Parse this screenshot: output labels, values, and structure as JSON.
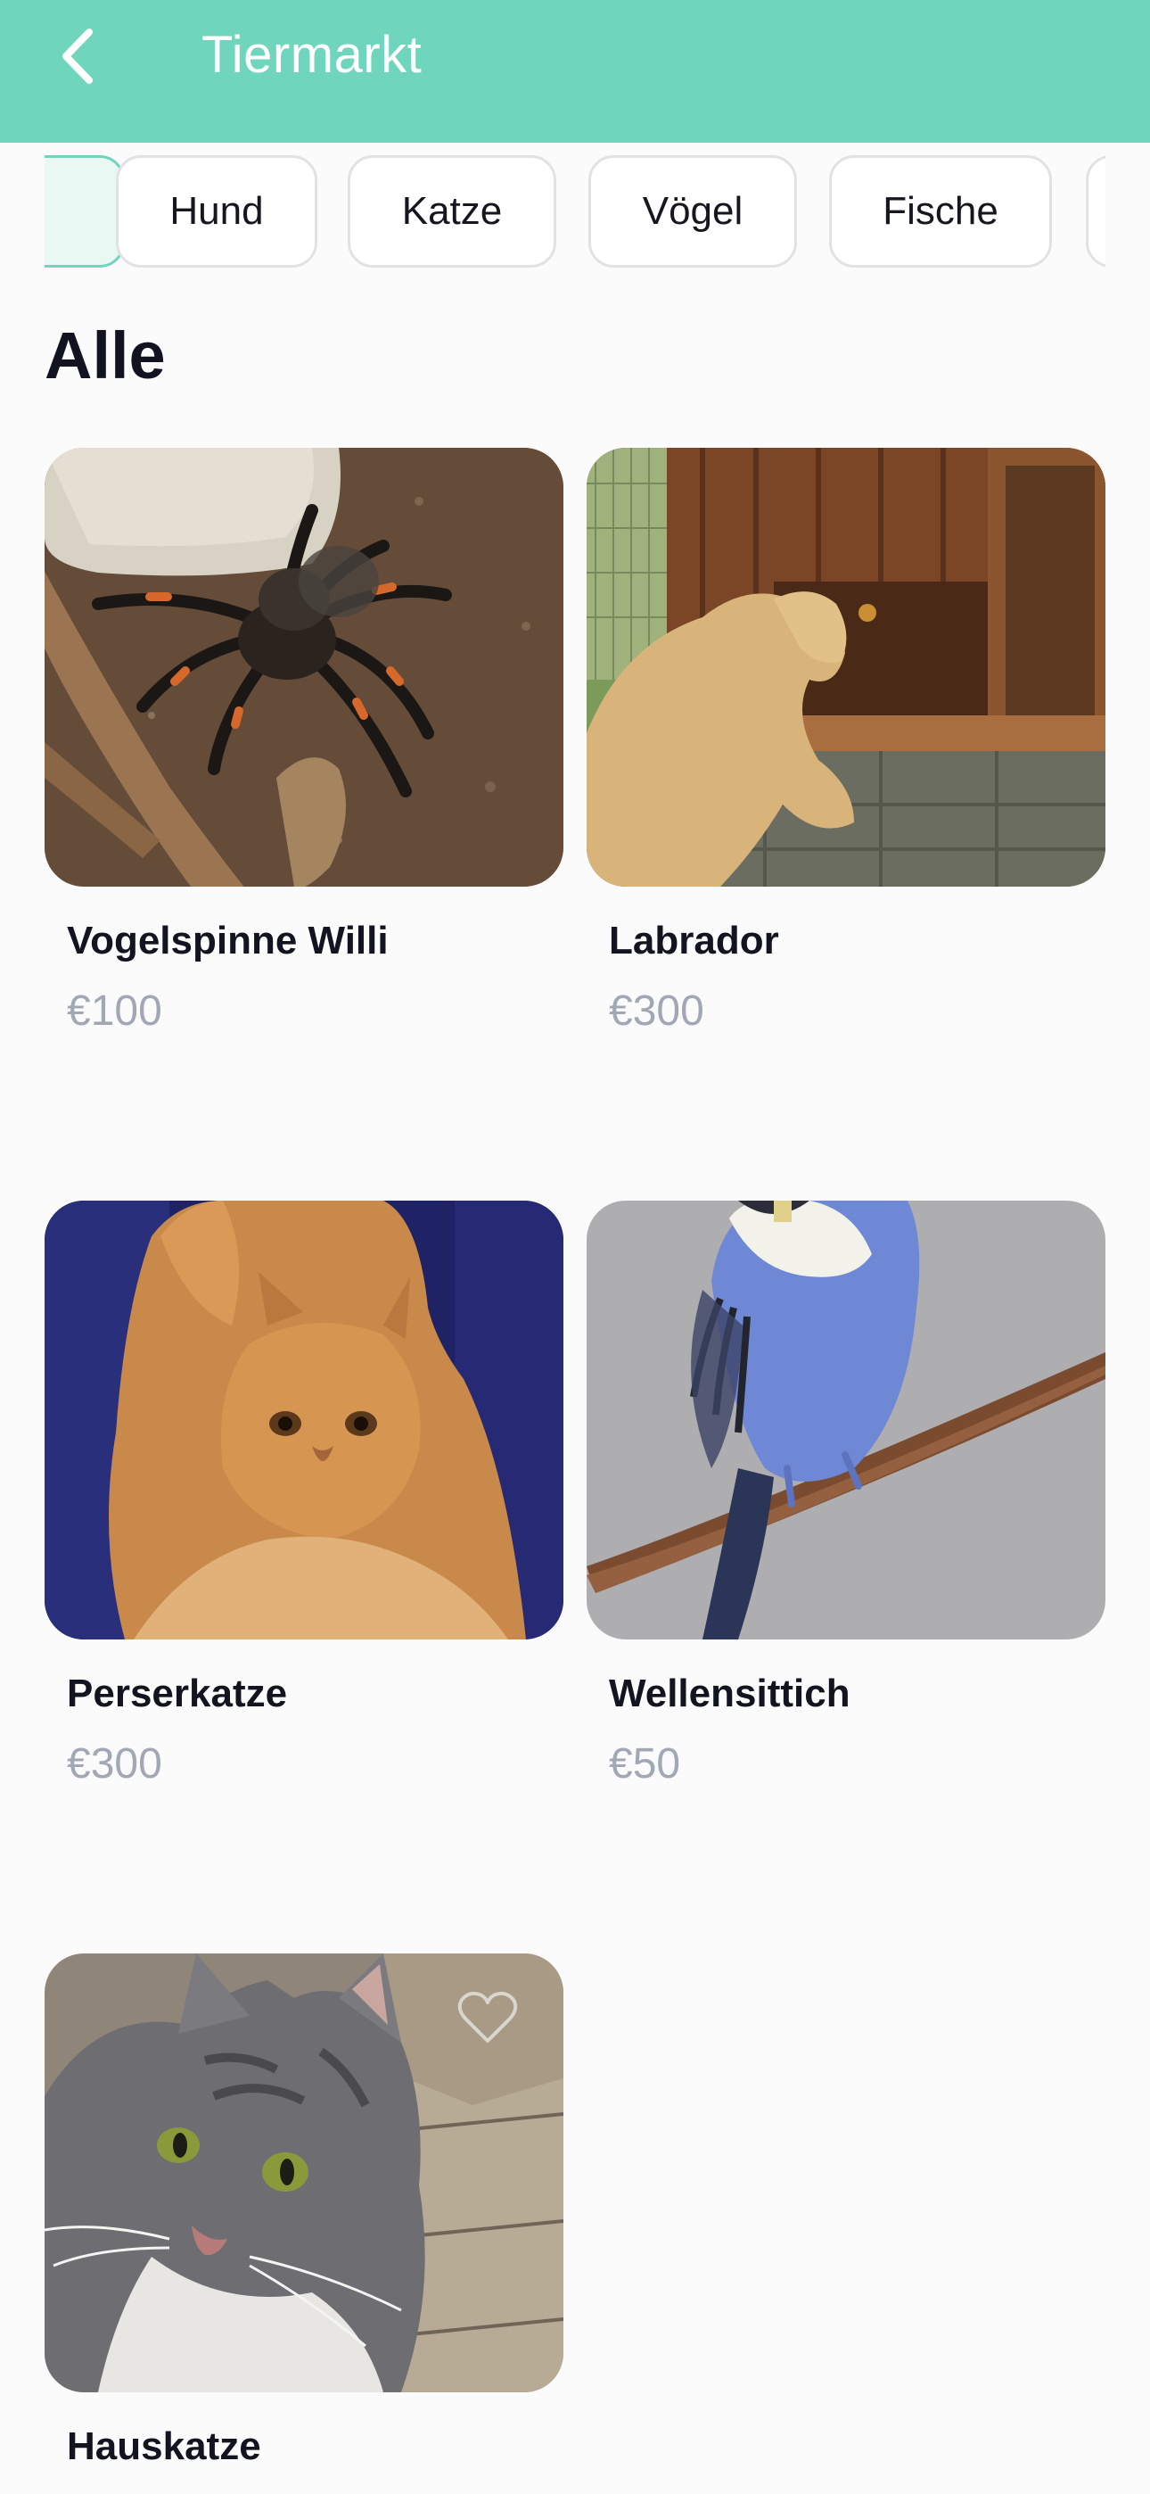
{
  "header": {
    "title": "Tiermarkt"
  },
  "categories": [
    "Hund",
    "Katze",
    "Vögel",
    "Fische"
  ],
  "section": {
    "title": "Alle"
  },
  "listings": [
    {
      "name": "Vogelspinne Willi",
      "price": "€100"
    },
    {
      "name": "Labrador",
      "price": "€300"
    },
    {
      "name": "Perserkatze",
      "price": "€300"
    },
    {
      "name": "Wellensittich",
      "price": "€50"
    },
    {
      "name": "Hauskatze",
      "price": ""
    }
  ],
  "colors": {
    "accent": "#6fd5bc",
    "price": "#a2a7b5",
    "text": "#121420"
  }
}
